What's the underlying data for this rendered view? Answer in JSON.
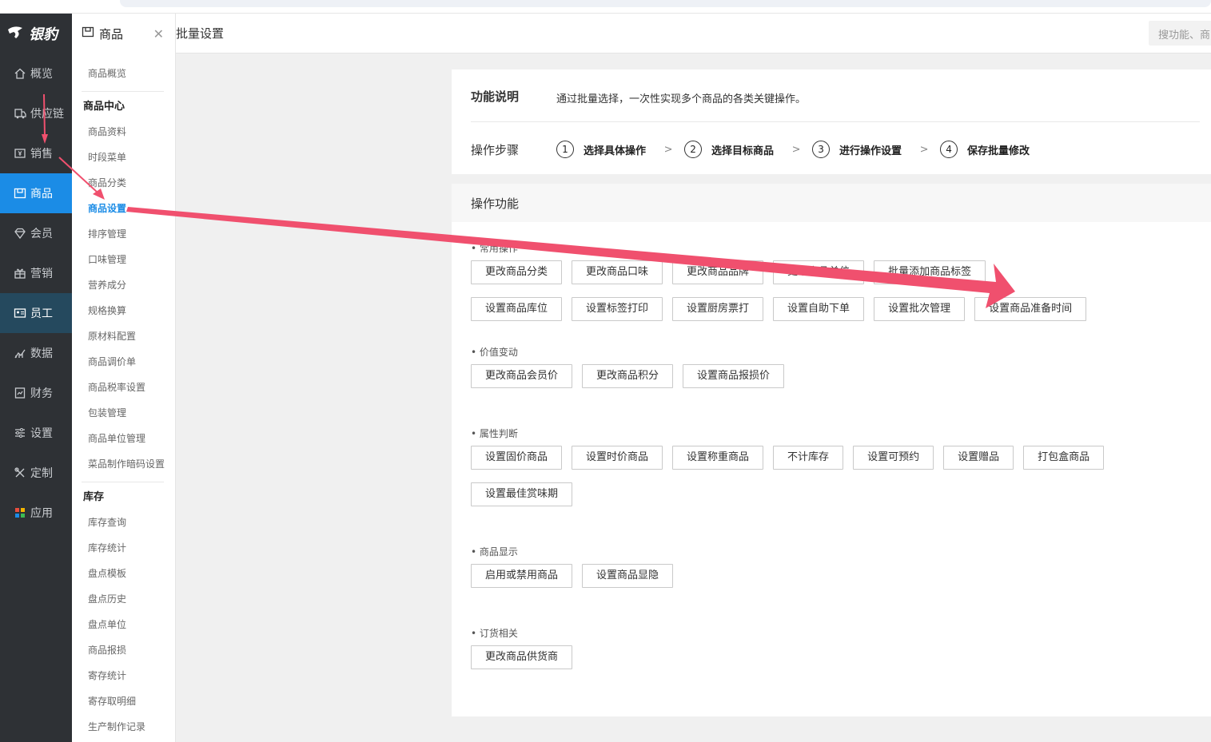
{
  "logo": {
    "text": "银豹"
  },
  "nav": [
    {
      "label": "概览",
      "icon": "home-icon"
    },
    {
      "label": "供应链",
      "icon": "truck-icon"
    },
    {
      "label": "销售",
      "icon": "yen-icon"
    },
    {
      "label": "商品",
      "icon": "product-icon"
    },
    {
      "label": "会员",
      "icon": "diamond-icon"
    },
    {
      "label": "营销",
      "icon": "gift-icon"
    },
    {
      "label": "员工",
      "icon": "id-card-icon"
    },
    {
      "label": "数据",
      "icon": "chart-icon"
    },
    {
      "label": "财务",
      "icon": "finance-icon"
    },
    {
      "label": "设置",
      "icon": "sliders-icon"
    },
    {
      "label": "定制",
      "icon": "tools-icon"
    },
    {
      "label": "应用",
      "icon": "apps-icon"
    }
  ],
  "submenu": {
    "title": "商品",
    "overview": "商品概览",
    "group1": "商品中心",
    "group1_items": [
      "商品资料",
      "时段菜单",
      "商品分类",
      "商品设置",
      "排序管理",
      "口味管理",
      "营养成分",
      "规格换算",
      "原材料配置",
      "商品调价单",
      "商品税率设置",
      "包装管理",
      "商品单位管理",
      "菜品制作暗码设置"
    ],
    "group2": "库存",
    "group2_items": [
      "库存查询",
      "库存统计",
      "盘点模板",
      "盘点历史",
      "盘点单位",
      "商品报损",
      "寄存统计",
      "寄存取明细",
      "生产制作记录"
    ]
  },
  "topbar": {
    "crumb": "批量设置",
    "search_placeholder": "搜功能、商"
  },
  "info": {
    "func_label": "功能说明",
    "func_desc": "通过批量选择，一次性实现多个商品的各类关键操作。",
    "steps_label": "操作步骤",
    "steps": [
      {
        "num": "1",
        "text": "选择具体操作"
      },
      {
        "num": "2",
        "text": "选择目标商品"
      },
      {
        "num": "3",
        "text": "进行操作设置"
      },
      {
        "num": "4",
        "text": "保存批量修改"
      }
    ],
    "arrow": ">"
  },
  "ops": {
    "title": "操作功能",
    "sections": [
      {
        "title": "• 常用操作",
        "rows": [
          [
            "更改商品分类",
            "更改商品口味",
            "更改商品品牌",
            "更改商品单位",
            "批量添加商品标签"
          ],
          [
            "设置商品库位",
            "设置标签打印",
            "设置厨房票打",
            "设置自助下单",
            "设置批次管理",
            "设置商品准备时间"
          ]
        ]
      },
      {
        "title": "• 价值变动",
        "rows": [
          [
            "更改商品会员价",
            "更改商品积分",
            "设置商品报损价"
          ]
        ]
      },
      {
        "title": "• 属性判断",
        "rows": [
          [
            "设置固价商品",
            "设置时价商品",
            "设置称重商品",
            "不计库存",
            "设置可预约",
            "设置赠品",
            "打包盒商品"
          ],
          [
            "设置最佳赏味期"
          ]
        ]
      },
      {
        "title": "• 商品显示",
        "rows": [
          [
            "启用或禁用商品",
            "设置商品显隐"
          ]
        ]
      },
      {
        "title": "• 订货相关",
        "rows": [
          [
            "更改商品供货商"
          ]
        ]
      }
    ]
  },
  "colors": {
    "accent": "#1b8ce6",
    "sidebar": "#2e3135",
    "annotation": "#f0506e"
  }
}
